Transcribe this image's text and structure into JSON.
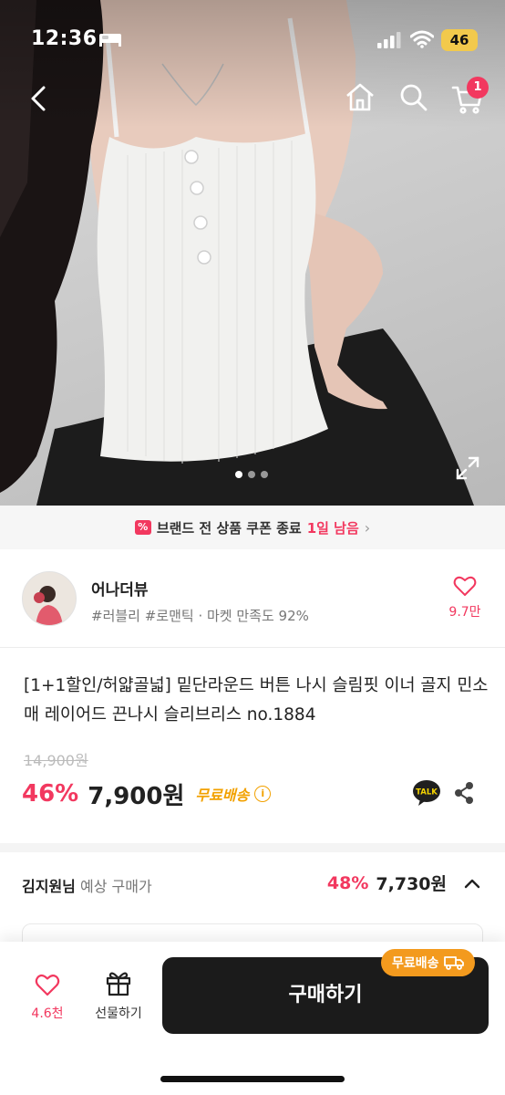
{
  "status_bar": {
    "time": "12:36",
    "battery": "46",
    "icons": [
      "bed-icon",
      "signal-icon",
      "wifi-icon"
    ]
  },
  "nav": {
    "icons": [
      "chevron-left-icon",
      "home-icon",
      "search-icon",
      "cart-icon"
    ],
    "cart_badge": "1"
  },
  "hero": {
    "image_count": 3,
    "active_index": 0,
    "expand_icon": "expand-icon"
  },
  "coupon_banner": {
    "text": "브랜드 전 상품 쿠폰 종료",
    "highlight": "1일 남음",
    "icon": "coupon-icon"
  },
  "store": {
    "name": "어나더뷰",
    "meta": "#러블리 #로맨틱 · 마켓 만족도 92%",
    "like_count": "9.7만"
  },
  "product": {
    "title": "[1+1할인/허얇골넓] 밑단라운드 버튼 나시 슬림핏 이너 골지 민소매 레이어드 끈나시 슬리브리스 no.1884",
    "original_price": "14,900원",
    "discount": "46%",
    "price": "7,900원",
    "free_shipping": "무료배송",
    "talk_label": "TALK"
  },
  "member_price": {
    "name": "김지원님",
    "label": " 예상 구매가",
    "discount": "48%",
    "price": "7,730원"
  },
  "bottom_bar": {
    "wish_count": "4.6천",
    "gift_label": "선물하기",
    "buy_label": "구매하기",
    "shipping_badge": "무료배송"
  },
  "colors": {
    "accent": "#f2385f",
    "shipping": "#f2a100",
    "buy_button": "#1b1b1b"
  }
}
